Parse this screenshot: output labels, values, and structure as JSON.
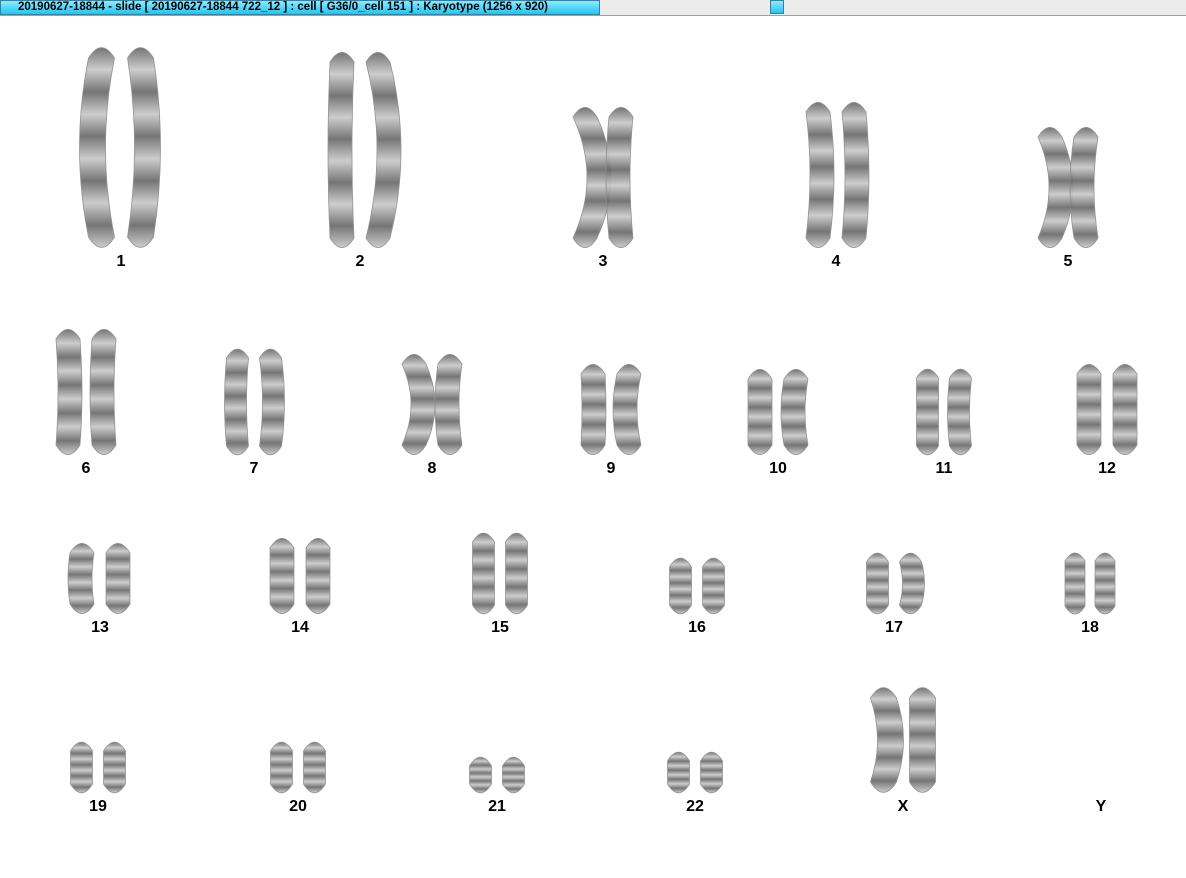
{
  "window": {
    "title": "20190627-18844 - slide [ 20190627-18844 722_12 ] : cell [ G36/0_cell 151 ] : Karyotype  (1256 x 920)"
  },
  "karyotype": {
    "chromosomes": [
      {
        "label": "1"
      },
      {
        "label": "2"
      },
      {
        "label": "3"
      },
      {
        "label": "4"
      },
      {
        "label": "5"
      },
      {
        "label": "6"
      },
      {
        "label": "7"
      },
      {
        "label": "8"
      },
      {
        "label": "9"
      },
      {
        "label": "10"
      },
      {
        "label": "11"
      },
      {
        "label": "12"
      },
      {
        "label": "13"
      },
      {
        "label": "14"
      },
      {
        "label": "15"
      },
      {
        "label": "16"
      },
      {
        "label": "17"
      },
      {
        "label": "18"
      },
      {
        "label": "19"
      },
      {
        "label": "20"
      },
      {
        "label": "21"
      },
      {
        "label": "22"
      },
      {
        "label": "X"
      },
      {
        "label": "Y"
      }
    ]
  }
}
